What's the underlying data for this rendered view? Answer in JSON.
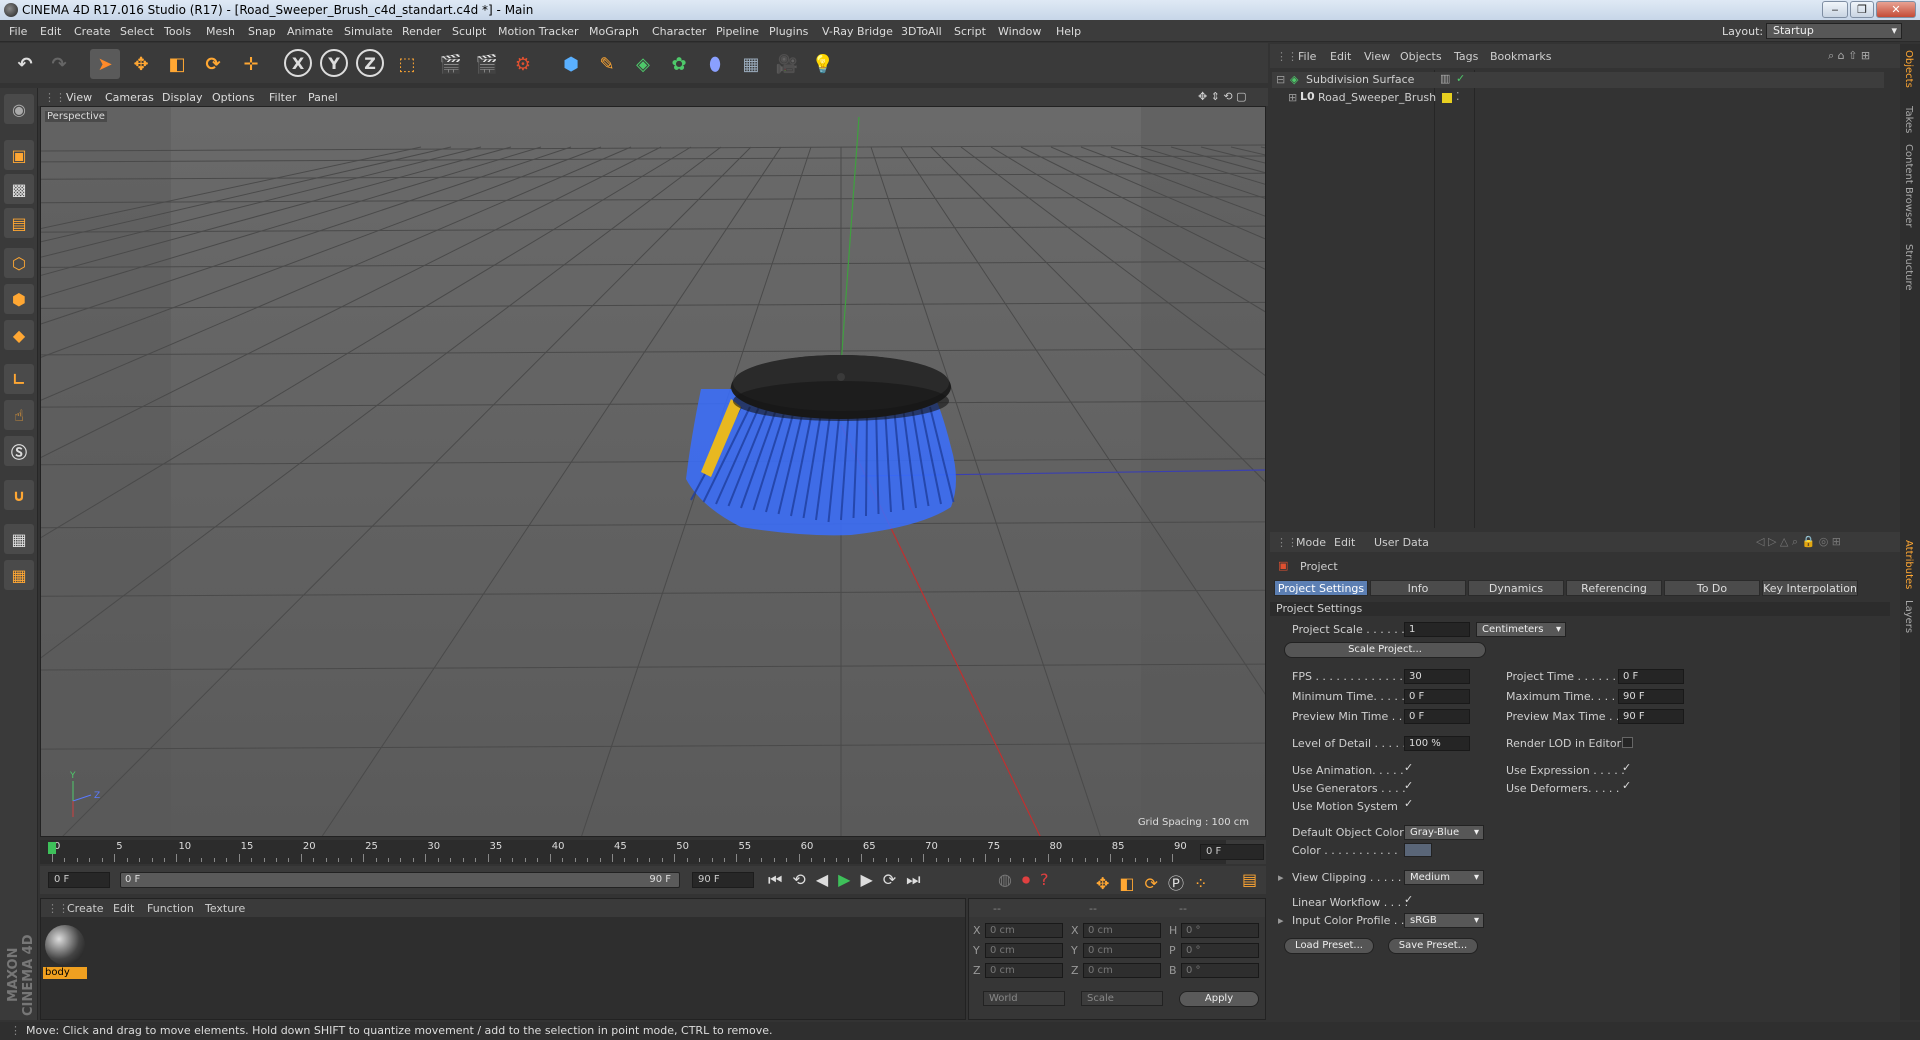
{
  "window": {
    "title": "CINEMA 4D R17.016 Studio (R17) - [Road_Sweeper_Brush_c4d_standart.c4d *] - Main"
  },
  "menu": [
    "File",
    "Edit",
    "Create",
    "Select",
    "Tools",
    "Mesh",
    "Snap",
    "Animate",
    "Simulate",
    "Render",
    "Sculpt",
    "Motion Tracker",
    "MoGraph",
    "Character",
    "Pipeline",
    "Plugins",
    "V-Ray Bridge",
    "3DToAll",
    "Script",
    "Window",
    "Help"
  ],
  "layout": {
    "label": "Layout:",
    "value": "Startup"
  },
  "toolbar": {
    "x_label": "X",
    "y_label": "Y",
    "z_label": "Z"
  },
  "viewport": {
    "menu": [
      "View",
      "Cameras",
      "Display",
      "Options",
      "Filter",
      "Panel"
    ],
    "name": "Perspective",
    "grid_spacing": "Grid Spacing : 100 cm"
  },
  "timeline": {
    "ticks": [
      "0",
      "5",
      "10",
      "15",
      "20",
      "25",
      "30",
      "35",
      "40",
      "45",
      "50",
      "55",
      "60",
      "65",
      "70",
      "75",
      "80",
      "85",
      "90"
    ],
    "current": "0 F",
    "start_field": "0 F",
    "range_start": "0 F",
    "range_end": "90 F",
    "end_field": "90 F"
  },
  "materials": {
    "menu": [
      "Create",
      "Edit",
      "Function",
      "Texture"
    ],
    "items": [
      {
        "name": "body"
      }
    ]
  },
  "coords": {
    "headers": [
      "--",
      "--",
      "--"
    ],
    "rows": [
      {
        "a": "X",
        "av": "0 cm",
        "b": "X",
        "bv": "0 cm",
        "c": "H",
        "cv": "0 °"
      },
      {
        "a": "Y",
        "av": "0 cm",
        "b": "Y",
        "bv": "0 cm",
        "c": "P",
        "cv": "0 °"
      },
      {
        "a": "Z",
        "av": "0 cm",
        "b": "Z",
        "bv": "0 cm",
        "c": "B",
        "cv": "0 °"
      }
    ],
    "mode1": "World",
    "mode2": "Scale",
    "apply": "Apply"
  },
  "objects": {
    "menu": [
      "File",
      "Edit",
      "View",
      "Objects",
      "Tags",
      "Bookmarks"
    ],
    "items": [
      {
        "name": "Subdivision Surface"
      },
      {
        "name": "Road_Sweeper_Brush"
      }
    ]
  },
  "attributes": {
    "menu": [
      "Mode",
      "Edit",
      "User Data"
    ],
    "title": "Project",
    "tabs": [
      "Project Settings",
      "Info",
      "Dynamics",
      "Referencing",
      "To Do",
      "Key Interpolation"
    ],
    "section": "Project Settings",
    "project_scale": {
      "label": "Project Scale . . . . . .",
      "value": "1",
      "unit": "Centimeters"
    },
    "scale_project": "Scale Project...",
    "fps": {
      "label": "FPS . . . . . . . . . . . . . .",
      "value": "30"
    },
    "project_time": {
      "label": "Project Time . . . . . . .",
      "value": "0 F"
    },
    "min_time": {
      "label": "Minimum Time. . . . .",
      "value": "0 F"
    },
    "max_time": {
      "label": "Maximum Time. . . . .",
      "value": "90 F"
    },
    "prev_min": {
      "label": "Preview Min Time . .",
      "value": "0 F"
    },
    "prev_max": {
      "label": "Preview Max Time . .",
      "value": "90 F"
    },
    "lod": {
      "label": "Level of Detail . . . . .",
      "value": "100 %"
    },
    "render_lod": "Render LOD in Editor",
    "use_animation": "Use Animation. . . . .",
    "use_expression": "Use Expression . . . . .",
    "use_generators": "Use Generators . . . .",
    "use_deformers": "Use Deformers. . . . .",
    "use_motion": "Use Motion System",
    "default_color": {
      "label": "Default Object Color",
      "value": "Gray-Blue"
    },
    "color_label": "Color . . . . . . . . . . .",
    "view_clipping": {
      "label": "View Clipping . . . . .",
      "value": "Medium"
    },
    "linear_workflow": "Linear Workflow . . . .",
    "input_profile": {
      "label": "Input Color Profile . .",
      "value": "sRGB"
    },
    "load_preset": "Load Preset...",
    "save_preset": "Save Preset..."
  },
  "side_tabs": [
    "Objects",
    "Takes",
    "Content Browser",
    "Structure"
  ],
  "side_tabs2": [
    "Attributes",
    "Layers"
  ],
  "status": "Move: Click and drag to move elements. Hold down SHIFT to quantize movement / add to the selection in point mode, CTRL to remove.",
  "logo": "MAXON CINEMA 4D",
  "colors": {
    "accent": "#5c7fb3",
    "brush_bristles": "#3a6fff",
    "highlight": "#e8b820"
  }
}
